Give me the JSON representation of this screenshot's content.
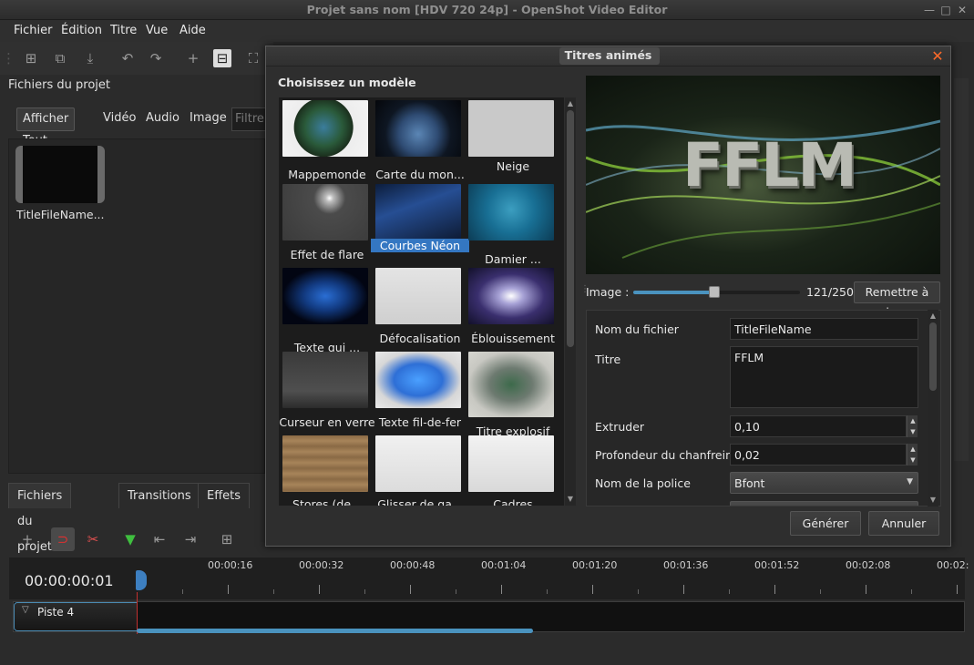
{
  "window": {
    "title": "Projet sans nom [HDV 720 24p] - OpenShot Video Editor"
  },
  "menu": [
    "Fichier",
    "Édition",
    "Titre",
    "Vue",
    "Aide"
  ],
  "project_files": {
    "title": "Fichiers du projet",
    "filters": [
      "Afficher Tout",
      "Vidéo",
      "Audio",
      "Image"
    ],
    "filter_placeholder": "Filtre",
    "file_name": "TitleFileName..."
  },
  "bottom_tabs": [
    "Fichiers du projet",
    "Transitions",
    "Effets"
  ],
  "timeline": {
    "timecode": "00:00:00:01",
    "ruler": [
      "00:00:16",
      "00:00:32",
      "00:00:48",
      "00:01:04",
      "00:01:20",
      "00:01:36",
      "00:01:52",
      "00:02:08",
      "00:02:"
    ],
    "track_label": "Piste 4"
  },
  "dialog": {
    "title": "Titres animés",
    "choose_label": "Choisissez un modèle",
    "templates": [
      {
        "label": "Mappemonde"
      },
      {
        "label": "Carte du mon..."
      },
      {
        "label": "Neige"
      },
      {
        "label": "Effet de flare"
      },
      {
        "label": "Courbes Néon",
        "selected": true
      },
      {
        "label": "Damier ..."
      },
      {
        "label": "Texte qui ..."
      },
      {
        "label": "Défocalisation"
      },
      {
        "label": "Éblouissement"
      },
      {
        "label": "Curseur en verre"
      },
      {
        "label": "Texte fil-de-fer"
      },
      {
        "label": "Titre explosif"
      },
      {
        "label": "Stores (de..."
      },
      {
        "label": "Glisser de ga..."
      },
      {
        "label": "Cadres"
      }
    ],
    "preview_text": "FFLM",
    "frame_label": "Image :",
    "frame_value": "121/250",
    "frame_fraction": 0.484,
    "refresh_button": "Remettre à jour",
    "properties": {
      "file_name_label": "Nom du fichier",
      "file_name_value": "TitleFileName",
      "title_label": "Titre",
      "title_value": "FFLM",
      "extrude_label": "Extruder",
      "extrude_value": "0,10",
      "bevel_label": "Profondeur du chanfrein",
      "bevel_value": "0,02",
      "font_label": "Nom de la police",
      "font_value": "Bfont"
    },
    "generate_button": "Générer",
    "cancel_button": "Annuler"
  },
  "colors": {
    "accent": "#3477c2",
    "timeline_blue": "#4a93bf",
    "playhead": "#c23030",
    "close": "#ff6a2a"
  }
}
